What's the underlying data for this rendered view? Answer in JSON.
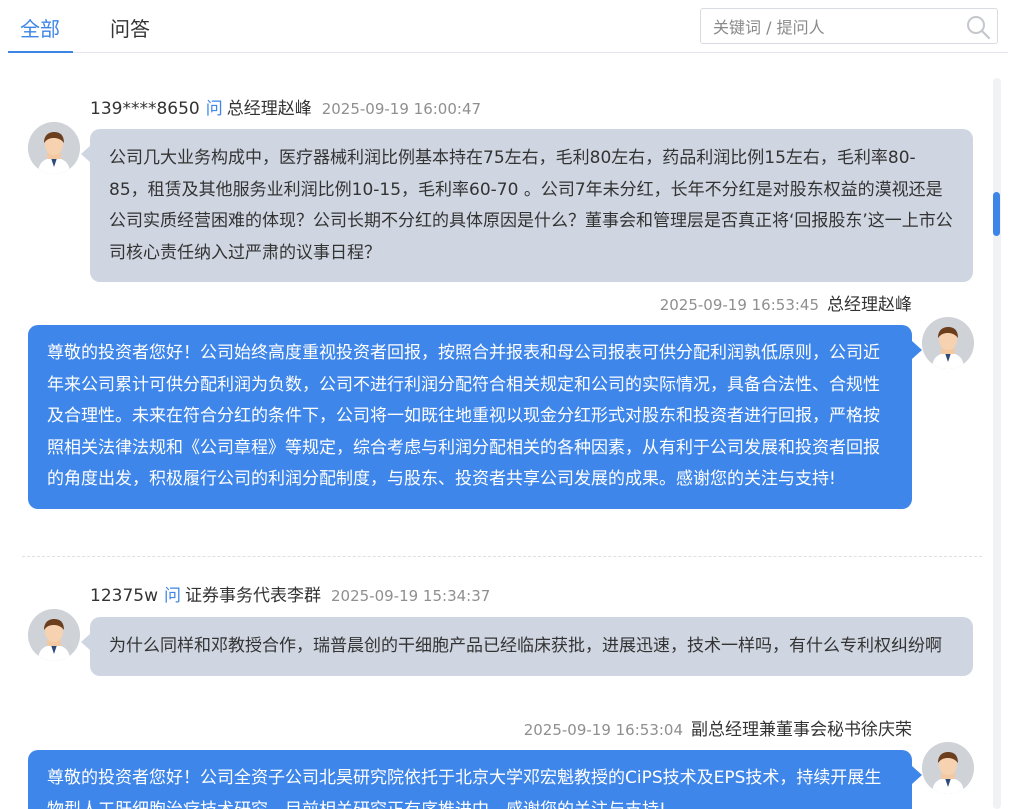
{
  "tabs": {
    "all": "全部",
    "qa": "问答"
  },
  "search": {
    "placeholder": "关键词 / 提问人",
    "icon": "search-icon"
  },
  "accent_color": "#3d86e8",
  "items": [
    {
      "question": {
        "user": "139****8650",
        "ask_word": "问",
        "to": "总经理赵峰",
        "time": "2025-09-19 16:00:47",
        "text": "公司几大业务构成中，医疗器械利润比例基本持在75左右，毛利80左右，药品利润比例15左右，毛利率80-85，租赁及其他服务业利润比例10-15，毛利率60-70 。公司7年未分红，长年不分红是对股东权益的漠视还是公司实质经营困难的体现？公司长期不分红的具体原因是什么？董事会和管理层是否真正将‘回报股东’这一上市公司核心责任纳入过严肃的议事日程？"
      },
      "answer": {
        "time": "2025-09-19 16:53:45",
        "who": "总经理赵峰",
        "text": "尊敬的投资者您好！公司始终高度重视投资者回报，按照合并报表和母公司报表可供分配利润孰低原则，公司近年来公司累计可供分配利润为负数，公司不进行利润分配符合相关规定和公司的实际情况，具备合法性、合规性及合理性。未来在符合分红的条件下，公司将一如既往地重视以现金分红形式对股东和投资者进行回报，严格按照相关法律法规和《公司章程》等规定，综合考虑与利润分配相关的各种因素，从有利于公司发展和投资者回报的角度出发，积极履行公司的利润分配制度，与股东、投资者共享公司发展的成果。感谢您的关注与支持!"
      }
    },
    {
      "question": {
        "user": "12375w",
        "ask_word": "问",
        "to": "证券事务代表李群",
        "time": "2025-09-19 15:34:37",
        "text": "为什么同样和邓教授合作，瑞普晨创的干细胞产品已经临床获批，进展迅速，技术一样吗，有什么专利权纠纷啊"
      },
      "answer": {
        "time": "2025-09-19 16:53:04",
        "who": "副总经理兼董事会秘书徐庆荣",
        "text": "尊敬的投资者您好！公司全资子公司北昊研究院依托于北京大学邓宏魁教授的CiPS技术及EPS技术，持续开展生物型人工肝细胞治疗技术研究，目前相关研究正有序推进中，感谢您的关注与支持!"
      }
    }
  ]
}
